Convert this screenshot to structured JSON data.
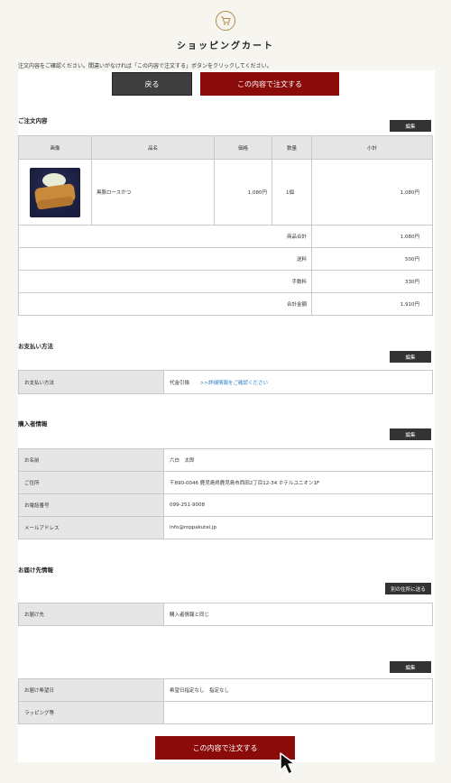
{
  "header": {
    "icon": "cart-icon",
    "title": "ショッピングカート"
  },
  "instruction": "注文内容をご確認ください。間違いがなければ「この内容で注文する」ボタンをクリックしてください。",
  "buttons": {
    "back": "戻る",
    "order": "この内容で注文する",
    "edit": "編集",
    "other_address": "別の住所に送る"
  },
  "order": {
    "section_title": "ご注文内容",
    "headers": [
      "画像",
      "品名",
      "価格",
      "数量",
      "小計"
    ],
    "item": {
      "name": "黒豚ロースかつ",
      "price": "1,080円",
      "qty": "1個",
      "subtotal": "1,080円"
    },
    "totals": [
      {
        "label": "商品合計",
        "value": "1,080円"
      },
      {
        "label": "送料",
        "value": "500円"
      },
      {
        "label": "手数料",
        "value": "330円"
      },
      {
        "label": "合計金額",
        "value": "1,910円"
      }
    ]
  },
  "payment": {
    "section_title": "お支払い方法",
    "label": "お支払い方法",
    "value": "代金引換",
    "link": ">>詳細情報をご確認ください"
  },
  "buyer": {
    "section_title": "購入者情報",
    "rows": [
      {
        "label": "お名前",
        "value": "六白　太郎"
      },
      {
        "label": "ご住所",
        "value": "〒890-0046 鹿児島県鹿児島市西田2丁目12-34 ホテルユニオン1F"
      },
      {
        "label": "お電話番号",
        "value": "099-251-9008"
      },
      {
        "label": "メールアドレス",
        "value": "info@roppakutei.jp"
      }
    ]
  },
  "delivery": {
    "section_title": "お届け先情報",
    "label": "お届け先",
    "value": "購入者情報と同じ"
  },
  "delivery_options": {
    "rows": [
      {
        "label": "お届け希望日",
        "value": "希望日指定なし　指定なし"
      },
      {
        "label": "ラッピング等",
        "value": ""
      }
    ]
  }
}
